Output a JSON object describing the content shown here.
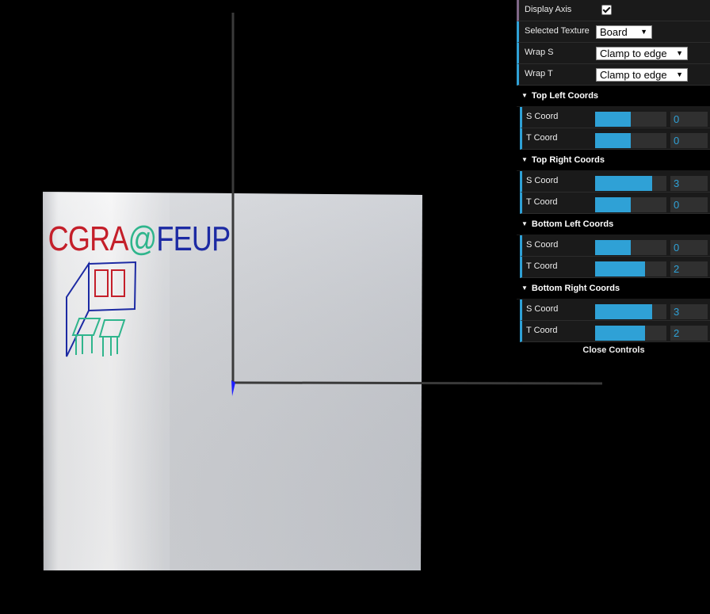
{
  "scene": {
    "board_text": "CGRA@FEUP",
    "colors": {
      "board": "#c9ccd3",
      "x_axis": "#3a3a3a",
      "y_axis": "#3a3a3a",
      "z_axis": "#2020ff",
      "text_red": "#c41f2a",
      "text_blue": "#1c2aa3",
      "drawing_green": "#2fb58c"
    }
  },
  "gui": {
    "display_axis": {
      "label": "Display Axis",
      "checked": true
    },
    "selected_texture": {
      "label": "Selected Texture",
      "value": "Board"
    },
    "wrap_s": {
      "label": "Wrap S",
      "value": "Clamp to edge"
    },
    "wrap_t": {
      "label": "Wrap T",
      "value": "Clamp to edge"
    },
    "folders": [
      {
        "title": "Top Left Coords",
        "s": {
          "label": "S Coord",
          "value": "0",
          "fraction": 0.5
        },
        "t": {
          "label": "T Coord",
          "value": "0",
          "fraction": 0.5
        }
      },
      {
        "title": "Top Right Coords",
        "s": {
          "label": "S Coord",
          "value": "3",
          "fraction": 0.8
        },
        "t": {
          "label": "T Coord",
          "value": "0",
          "fraction": 0.5
        }
      },
      {
        "title": "Bottom Left Coords",
        "s": {
          "label": "S Coord",
          "value": "0",
          "fraction": 0.5
        },
        "t": {
          "label": "T Coord",
          "value": "2",
          "fraction": 0.7
        }
      },
      {
        "title": "Bottom Right Coords",
        "s": {
          "label": "S Coord",
          "value": "3",
          "fraction": 0.8
        },
        "t": {
          "label": "T Coord",
          "value": "2",
          "fraction": 0.7
        }
      }
    ],
    "close_label": "Close Controls"
  }
}
